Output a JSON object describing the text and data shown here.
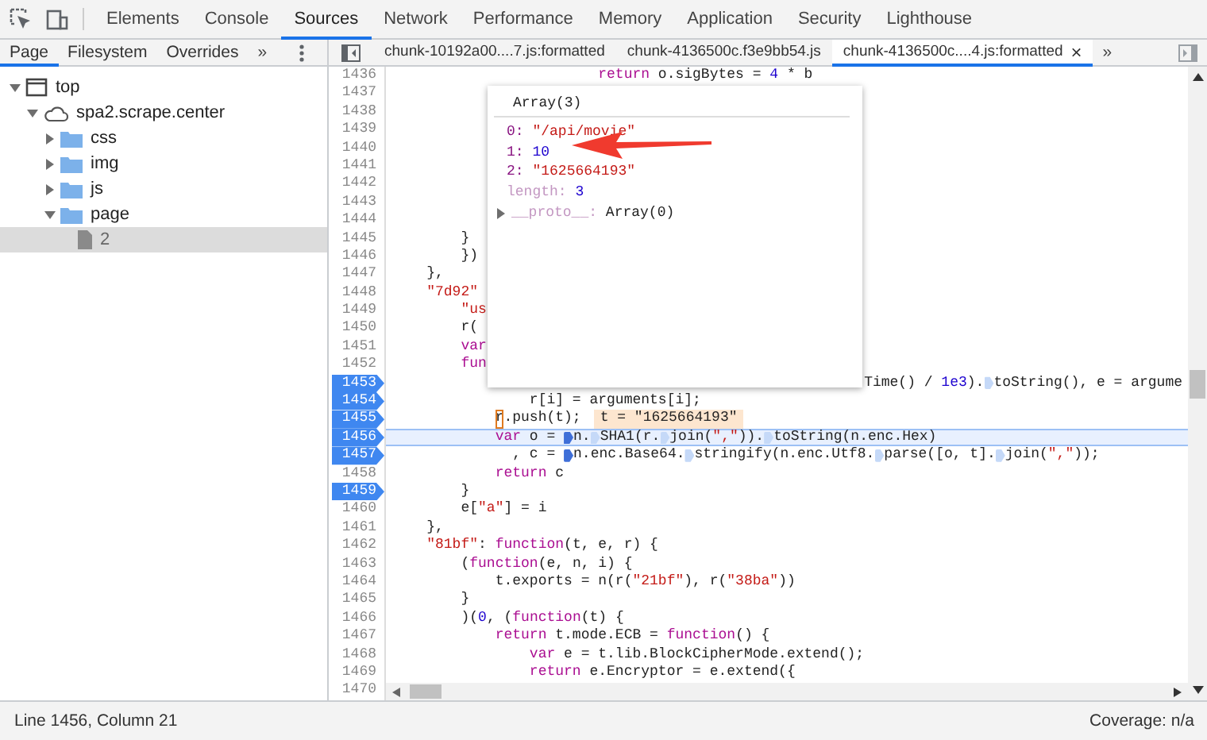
{
  "toolbar": {
    "tabs": [
      {
        "label": "Elements",
        "selected": false
      },
      {
        "label": "Console",
        "selected": false
      },
      {
        "label": "Sources",
        "selected": true
      },
      {
        "label": "Network",
        "selected": false
      },
      {
        "label": "Performance",
        "selected": false
      },
      {
        "label": "Memory",
        "selected": false
      },
      {
        "label": "Application",
        "selected": false
      },
      {
        "label": "Security",
        "selected": false
      },
      {
        "label": "Lighthouse",
        "selected": false
      }
    ]
  },
  "navigator": {
    "tabs": [
      {
        "label": "Page",
        "selected": true
      },
      {
        "label": "Filesystem",
        "selected": false
      },
      {
        "label": "Overrides",
        "selected": false
      }
    ],
    "more": "»",
    "tree": [
      {
        "label": "top",
        "kind": "frame",
        "expanded": true,
        "selected": false,
        "children": [
          {
            "label": "spa2.scrape.center",
            "kind": "domain",
            "expanded": true,
            "selected": false,
            "children": [
              {
                "label": "css",
                "kind": "folder",
                "expanded": false,
                "selected": false
              },
              {
                "label": "img",
                "kind": "folder",
                "expanded": false,
                "selected": false
              },
              {
                "label": "js",
                "kind": "folder",
                "expanded": false,
                "selected": false
              },
              {
                "label": "page",
                "kind": "folder",
                "expanded": true,
                "selected": false,
                "children": [
                  {
                    "label": "2",
                    "kind": "file",
                    "selected": true
                  }
                ]
              }
            ]
          }
        ]
      }
    ]
  },
  "editor": {
    "tabs": [
      {
        "label": "chunk-10192a00....7.js:formatted",
        "selected": false
      },
      {
        "label": "chunk-4136500c.f3e9bb54.js",
        "selected": false
      },
      {
        "label": "chunk-4136500c....4.js:formatted",
        "selected": true,
        "close": "×"
      }
    ],
    "more": "»",
    "lines": [
      {
        "number": "1436",
        "breakpoint": false,
        "current": false,
        "tokens": [
          {
            "text": "                        return",
            "kind": "keyword"
          },
          {
            "text": " o.sigBytes = ",
            "kind": "plain"
          },
          {
            "text": "4",
            "kind": "number"
          },
          {
            "text": " * b",
            "kind": "plain"
          }
        ]
      },
      {
        "number": "1437",
        "breakpoint": false,
        "current": false
      },
      {
        "number": "1438",
        "breakpoint": false,
        "current": false
      },
      {
        "number": "1439",
        "breakpoint": false,
        "current": false
      },
      {
        "number": "1440",
        "breakpoint": false,
        "current": false
      },
      {
        "number": "1441",
        "breakpoint": false,
        "current": false
      },
      {
        "number": "1442",
        "breakpoint": false,
        "current": false
      },
      {
        "number": "1443",
        "breakpoint": false,
        "current": false
      },
      {
        "number": "1444",
        "breakpoint": false,
        "current": false
      },
      {
        "number": "1445",
        "breakpoint": false,
        "current": false,
        "tokens": [
          {
            "text": "        }",
            "kind": "plain"
          }
        ]
      },
      {
        "number": "1446",
        "breakpoint": false,
        "current": false,
        "tokens": [
          {
            "text": "        })",
            "kind": "plain"
          }
        ]
      },
      {
        "number": "1447",
        "breakpoint": false,
        "current": false,
        "tokens": [
          {
            "text": "    },",
            "kind": "plain"
          }
        ]
      },
      {
        "number": "1448",
        "breakpoint": false,
        "current": false,
        "tokens": [
          {
            "text": "    \"7d92\"",
            "kind": "string"
          }
        ]
      },
      {
        "number": "1449",
        "breakpoint": false,
        "current": false,
        "tokens": [
          {
            "text": "        \"us",
            "kind": "string"
          }
        ]
      },
      {
        "number": "1450",
        "breakpoint": false,
        "current": false,
        "tokens": [
          {
            "text": "        r(",
            "kind": "plain"
          }
        ]
      },
      {
        "number": "1451",
        "breakpoint": false,
        "current": false,
        "tokens": [
          {
            "text": "        var",
            "kind": "keyword"
          }
        ]
      },
      {
        "number": "1452",
        "breakpoint": false,
        "current": false,
        "tokens": [
          {
            "text": "        fun",
            "kind": "keyword"
          }
        ]
      },
      {
        "number": "1453",
        "breakpoint": true,
        "current": false,
        "tokens": [
          {
            "text": "                                                       Time() / ",
            "kind": "plain"
          },
          {
            "text": "1e3",
            "kind": "number"
          },
          {
            "text": ").",
            "kind": "plain"
          },
          {
            "kind": "marker",
            "active": false
          },
          {
            "text": "toString(), e = argume",
            "kind": "plain"
          }
        ]
      },
      {
        "number": "1454",
        "breakpoint": true,
        "current": false,
        "tokens": [
          {
            "text": "                r[i] = arguments[i];",
            "kind": "plain"
          }
        ]
      },
      {
        "number": "1455",
        "breakpoint": true,
        "current": false,
        "tokens": [
          {
            "text": "            r",
            "kind": "cursor"
          },
          {
            "text": ".push(t);",
            "kind": "plain"
          },
          {
            "text": "t = \"1625664193\"",
            "kind": "value"
          }
        ]
      },
      {
        "number": "1456",
        "breakpoint": true,
        "current": true,
        "tokens": [
          {
            "text": "            var",
            "kind": "keyword"
          },
          {
            "text": " o = ",
            "kind": "plain"
          },
          {
            "kind": "marker",
            "active": true
          },
          {
            "text": "n.",
            "kind": "plain"
          },
          {
            "kind": "marker",
            "active": false
          },
          {
            "text": "SHA1(r.",
            "kind": "plain"
          },
          {
            "kind": "marker",
            "active": false
          },
          {
            "text": "join(",
            "kind": "plain"
          },
          {
            "text": "\",\"",
            "kind": "string"
          },
          {
            "text": ")).",
            "kind": "plain"
          },
          {
            "kind": "marker",
            "active": false
          },
          {
            "text": "toString(n.enc.Hex)",
            "kind": "plain"
          }
        ]
      },
      {
        "number": "1457",
        "breakpoint": true,
        "current": false,
        "tokens": [
          {
            "text": "              , c = ",
            "kind": "plain"
          },
          {
            "kind": "marker",
            "active": true
          },
          {
            "text": "n.enc.Base64.",
            "kind": "plain"
          },
          {
            "kind": "marker",
            "active": false
          },
          {
            "text": "stringify(n.enc.Utf8.",
            "kind": "plain"
          },
          {
            "kind": "marker",
            "active": false
          },
          {
            "text": "parse([o, t].",
            "kind": "plain"
          },
          {
            "kind": "marker",
            "active": false
          },
          {
            "text": "join(",
            "kind": "plain"
          },
          {
            "text": "\",\"",
            "kind": "string"
          },
          {
            "text": "));",
            "kind": "plain"
          }
        ]
      },
      {
        "number": "1458",
        "breakpoint": false,
        "current": false,
        "tokens": [
          {
            "text": "            return",
            "kind": "keyword"
          },
          {
            "text": " c",
            "kind": "plain"
          }
        ]
      },
      {
        "number": "1459",
        "breakpoint": true,
        "current": false,
        "tokens": [
          {
            "text": "        }",
            "kind": "plain"
          }
        ]
      },
      {
        "number": "1460",
        "breakpoint": false,
        "current": false,
        "tokens": [
          {
            "text": "        e[",
            "kind": "plain"
          },
          {
            "text": "\"a\"",
            "kind": "string"
          },
          {
            "text": "] = i",
            "kind": "plain"
          }
        ]
      },
      {
        "number": "1461",
        "breakpoint": false,
        "current": false,
        "tokens": [
          {
            "text": "    },",
            "kind": "plain"
          }
        ]
      },
      {
        "number": "1462",
        "breakpoint": false,
        "current": false,
        "tokens": [
          {
            "text": "    \"81bf\"",
            "kind": "string"
          },
          {
            "text": ": ",
            "kind": "plain"
          },
          {
            "text": "function",
            "kind": "keyword"
          },
          {
            "text": "(t, e, r) {",
            "kind": "plain"
          }
        ]
      },
      {
        "number": "1463",
        "breakpoint": false,
        "current": false,
        "tokens": [
          {
            "text": "        (",
            "kind": "plain"
          },
          {
            "text": "function",
            "kind": "keyword"
          },
          {
            "text": "(e, n, i) {",
            "kind": "plain"
          }
        ]
      },
      {
        "number": "1464",
        "breakpoint": false,
        "current": false,
        "tokens": [
          {
            "text": "            t.exports = n(r(",
            "kind": "plain"
          },
          {
            "text": "\"21bf\"",
            "kind": "string"
          },
          {
            "text": "), r(",
            "kind": "plain"
          },
          {
            "text": "\"38ba\"",
            "kind": "string"
          },
          {
            "text": "))",
            "kind": "plain"
          }
        ]
      },
      {
        "number": "1465",
        "breakpoint": false,
        "current": false,
        "tokens": [
          {
            "text": "        }",
            "kind": "plain"
          }
        ]
      },
      {
        "number": "1466",
        "breakpoint": false,
        "current": false,
        "tokens": [
          {
            "text": "        )(",
            "kind": "plain"
          },
          {
            "text": "0",
            "kind": "number"
          },
          {
            "text": ", (",
            "kind": "plain"
          },
          {
            "text": "function",
            "kind": "keyword"
          },
          {
            "text": "(t) {",
            "kind": "plain"
          }
        ]
      },
      {
        "number": "1467",
        "breakpoint": false,
        "current": false,
        "tokens": [
          {
            "text": "            return",
            "kind": "keyword"
          },
          {
            "text": " t.mode.ECB = ",
            "kind": "plain"
          },
          {
            "text": "function",
            "kind": "keyword"
          },
          {
            "text": "() {",
            "kind": "plain"
          }
        ]
      },
      {
        "number": "1468",
        "breakpoint": false,
        "current": false,
        "tokens": [
          {
            "text": "                var",
            "kind": "keyword"
          },
          {
            "text": " e = t.lib.BlockCipherMode.extend();",
            "kind": "plain"
          }
        ]
      },
      {
        "number": "1469",
        "breakpoint": false,
        "current": false,
        "tokens": [
          {
            "text": "                return",
            "kind": "keyword"
          },
          {
            "text": " e.Encryptor = e.extend({",
            "kind": "plain"
          }
        ]
      },
      {
        "number": "1470",
        "breakpoint": false,
        "current": false
      }
    ],
    "preview": {
      "title": "Array(3)",
      "entries": [
        {
          "key": "0:",
          "value": "\"/api/movie\"",
          "kind": "string",
          "enumerable": true
        },
        {
          "key": "1:",
          "value": "10",
          "kind": "number",
          "enumerable": true
        },
        {
          "key": "2:",
          "value": "\"1625664193\"",
          "kind": "string",
          "enumerable": true
        },
        {
          "key": "length:",
          "value": "3",
          "kind": "number",
          "enumerable": false
        }
      ],
      "proto": {
        "key": "__proto__:",
        "value": "Array(0)",
        "expanded": false
      }
    }
  },
  "status_bar": {
    "position": "Line 1456, Column 21",
    "coverage": "Coverage: n/a"
  }
}
